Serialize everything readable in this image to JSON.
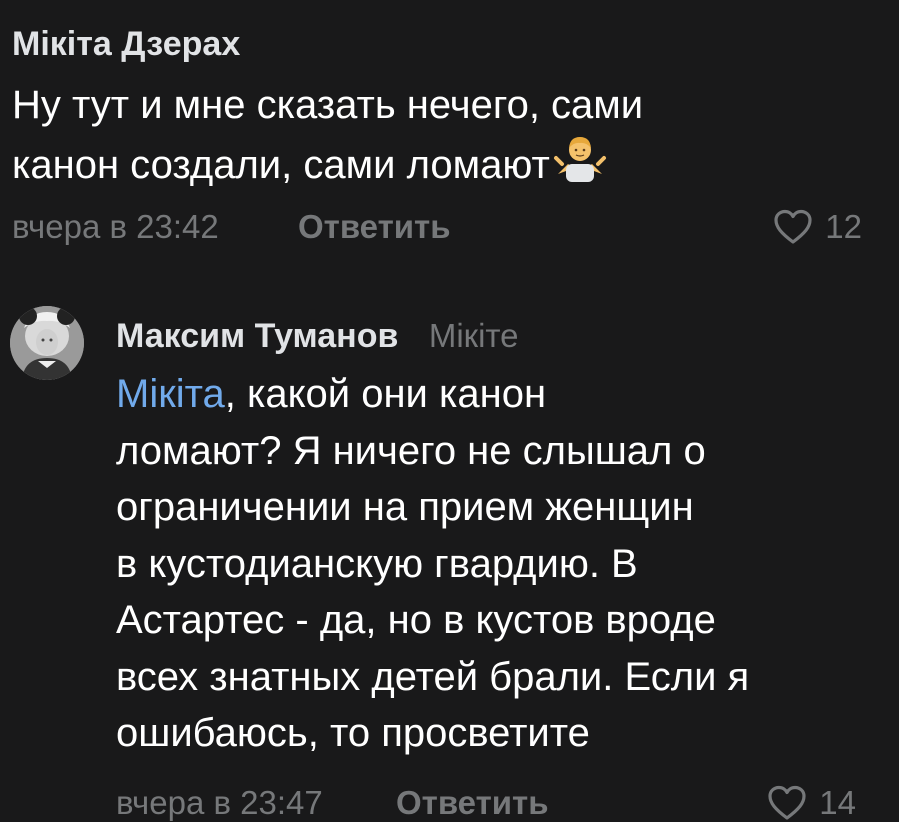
{
  "comments": [
    {
      "author": "Мікіта Дзерах",
      "text_line1": "Ну тут и мне сказать нечего, сами",
      "text_line2": "канон создали, сами ломают",
      "emoji": "person-shrugging-emoji",
      "time": "вчера в 23:42",
      "reply_label": "Ответить",
      "likes": "12"
    },
    {
      "author": "Максим Туманов",
      "reply_to": "Мікіте",
      "mention": "Мікіта",
      "text_after_mention": ", какой они канон",
      "text_lines": [
        "ломают? Я ничего не слышал о",
        "ограничении на прием женщин",
        "в кустодианскую гвардию. В",
        "Астартес - да, но в кустов вроде",
        "всех знатных детей брали. Если я",
        "ошибаюсь, то просветите"
      ],
      "time": "вчера в 23:47",
      "reply_label": "Ответить",
      "likes": "14"
    }
  ],
  "colors": {
    "background": "#19191a",
    "text": "#ffffff",
    "secondary": "#76787a",
    "link": "#71aaeb"
  }
}
